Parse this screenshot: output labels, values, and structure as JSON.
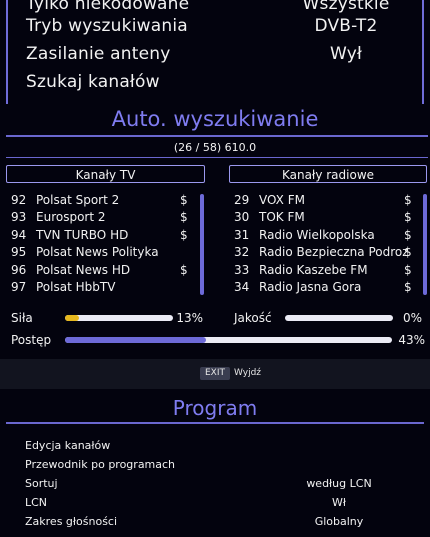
{
  "settings": [
    {
      "label": "Tylko niekodowane",
      "value": "Wszystkie"
    },
    {
      "label": "Tryb wyszukiwania",
      "value": "DVB-T2"
    },
    {
      "label": "Zasilanie anteny",
      "value": "Wył"
    },
    {
      "label": "Szukaj kanałów",
      "value": ""
    }
  ],
  "scan": {
    "title": "Auto. wyszukiwanie",
    "progress_info": "(26 / 58)  610.0"
  },
  "tv": {
    "header": "Kanały TV",
    "channels": [
      {
        "num": "92",
        "name": "Polsat Sport 2",
        "flag": "$"
      },
      {
        "num": "93",
        "name": "Eurosport 2",
        "flag": "$"
      },
      {
        "num": "94",
        "name": "TVN TURBO HD",
        "flag": "$"
      },
      {
        "num": "95",
        "name": "Polsat News Polityka",
        "flag": ""
      },
      {
        "num": "96",
        "name": "Polsat News HD",
        "flag": "$"
      },
      {
        "num": "97",
        "name": "Polsat  HbbTV",
        "flag": ""
      }
    ]
  },
  "radio": {
    "header": "Kanały radiowe",
    "channels": [
      {
        "num": "29",
        "name": "VOX FM",
        "flag": "$"
      },
      {
        "num": "30",
        "name": "TOK FM",
        "flag": "$"
      },
      {
        "num": "31",
        "name": "Radio Wielkopolska",
        "flag": "$"
      },
      {
        "num": "32",
        "name": "Radio Bezpieczna Podroz",
        "flag": "$"
      },
      {
        "num": "33",
        "name": "Radio Kaszebe FM",
        "flag": "$"
      },
      {
        "num": "34",
        "name": "Radio Jasna Gora",
        "flag": "$"
      }
    ]
  },
  "meters": {
    "signal": {
      "label": "Siła",
      "value": "13%",
      "fraction": 0.13,
      "color": "#e6b81e"
    },
    "quality": {
      "label": "Jakość",
      "value": "0%",
      "fraction": 0.0,
      "color": "#6d6ad8"
    },
    "progress": {
      "label": "Postęp",
      "value": "43%",
      "fraction": 0.43,
      "color": "#6d6ad8"
    }
  },
  "hint": {
    "key": "EXIT",
    "label": "Wyjdź"
  },
  "program": {
    "title": "Program",
    "items": [
      {
        "label": "Edycja kanałów",
        "value": ""
      },
      {
        "label": "Przewodnik po programach",
        "value": ""
      },
      {
        "label": "Sortuj",
        "value": "według LCN"
      },
      {
        "label": "LCN",
        "value": "Wł"
      },
      {
        "label": "Zakres głośności",
        "value": "Globalny"
      }
    ]
  },
  "colors": {
    "accent": "#7f7cf0",
    "line": "#6a67cf",
    "signal": "#e6b81e",
    "background": "#03030e"
  }
}
